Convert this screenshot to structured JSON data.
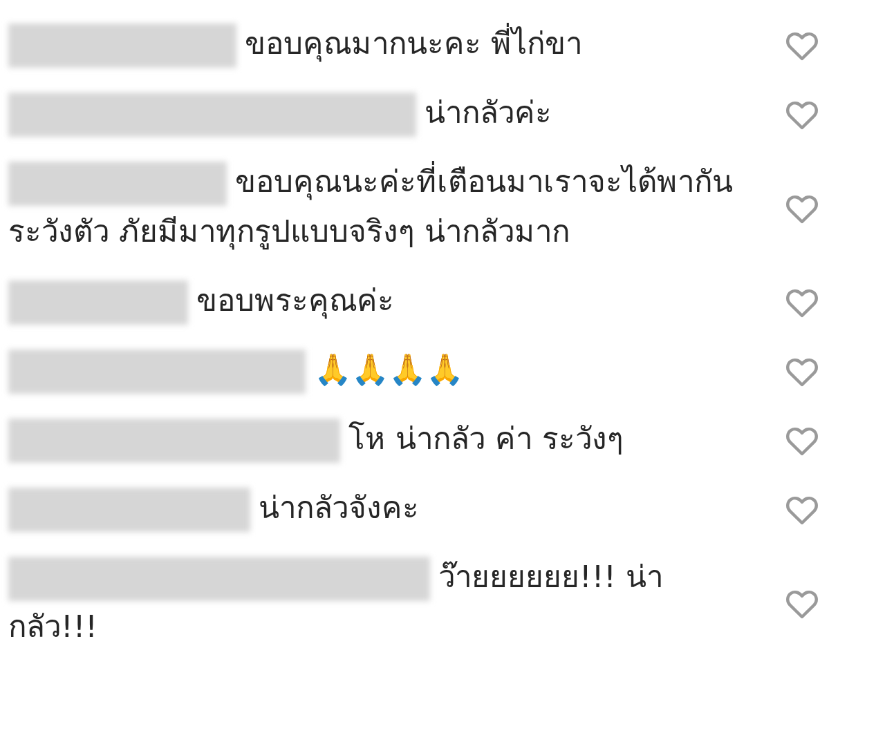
{
  "comments": [
    {
      "text": "ขอบคุณมากนะคะ พี่ไก่ขา",
      "liked": false
    },
    {
      "text": "น่ากลัวค่ะ",
      "liked": false
    },
    {
      "text": "ขอบคุณนะค่ะที่เตือนมาเราจะได้พากันระวังตัว ภัยมีมาทุกรูปแบบจริงๆ น่ากลัวมาก",
      "liked": false
    },
    {
      "text": "ขอบพระคุณค่ะ",
      "liked": false
    },
    {
      "text": "🙏🙏🙏🙏",
      "liked": false
    },
    {
      "text": "โห น่ากลัว ค่า ระวังๆ",
      "liked": false
    },
    {
      "text": "น่ากลัวจังคะ",
      "liked": false
    },
    {
      "text": "ว๊ายยยยยย!!! น่ากลัว!!!",
      "liked": false
    }
  ]
}
